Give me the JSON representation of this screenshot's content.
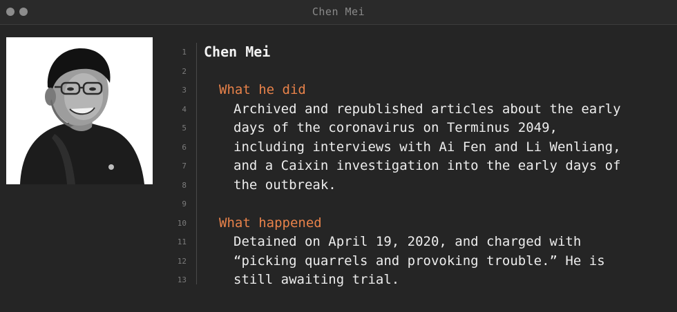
{
  "window": {
    "title": "Chen Mei"
  },
  "colors": {
    "background": "#252525",
    "titlebar": "#2a2a2a",
    "heading": "#e8824a",
    "text": "#ededed",
    "line_number": "#7c7c7c"
  },
  "photo": {
    "icon": "person-portrait-photo"
  },
  "editor": {
    "line_numbers": [
      "1",
      "2",
      "3",
      "4",
      "5",
      "6",
      "7",
      "8",
      "9",
      "10",
      "11",
      "12",
      "13"
    ],
    "name": "Chen Mei",
    "section1": {
      "heading": "What he did",
      "lines": [
        "Archived and republished articles about the early",
        "days of the coronavirus on Terminus 2049,",
        "including interviews with Ai Fen and Li Wenliang,",
        "and a Caixin investigation into the early days of",
        "the outbreak."
      ]
    },
    "section2": {
      "heading": "What happened",
      "lines": [
        "Detained on April 19, 2020, and charged with",
        "“picking quarrels and provoking trouble.” He is",
        "still awaiting trial."
      ]
    }
  }
}
